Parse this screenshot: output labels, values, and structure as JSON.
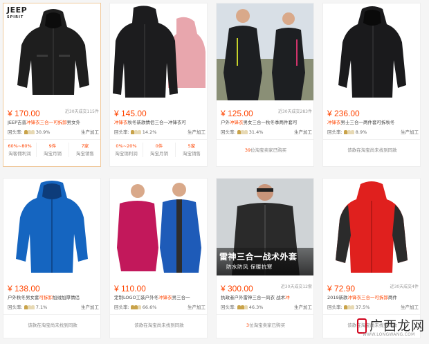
{
  "brand_logo": {
    "main": "JEEP",
    "sub": "SPIRIT"
  },
  "products": [
    {
      "price": "¥ 170.00",
      "sold": "近30天成交115件",
      "title_pre": "JEEP吉普",
      "title_hl": "冲锋衣三合一可拆卸",
      "title_post": "男女外",
      "shop_label": "回头率:",
      "rate": "30.9%",
      "supply": "生产加工",
      "stats": [
        {
          "value": "60%~80%",
          "label": "淘客佣利润"
        },
        {
          "value": "9件",
          "label": "淘宝月销"
        },
        {
          "value": "7家",
          "label": "淘宝销售"
        }
      ],
      "footer": null,
      "colors": {
        "jacket": "#1e1e1e",
        "accent": "#2b2b2b"
      }
    },
    {
      "price": "¥ 145.00",
      "sold": "",
      "title_pre": "",
      "title_hl": "冲锋衣",
      "title_post": "秋冬新款情侣三合一冲锋衣可",
      "shop_label": "回头率:",
      "rate": "14.2%",
      "supply": "生产加工",
      "stats": [
        {
          "value": "0%~20%",
          "label": "淘宝销利润"
        },
        {
          "value": "0件",
          "label": "淘宝月销"
        },
        {
          "value": "5家",
          "label": "淘宝销售"
        }
      ],
      "footer": null,
      "colors": {
        "jacket": "#1c1c1e",
        "accent": "#e8a6ad"
      }
    },
    {
      "price": "¥ 125.00",
      "sold": "近30天成交283件",
      "title_pre": "户外",
      "title_hl": "冲锋衣",
      "title_post": "男女三合一秋冬季两件套可",
      "shop_label": "回头率:",
      "rate": "31.4%",
      "supply": "生产加工",
      "stats": null,
      "footer": {
        "num": "39",
        "text": "位淘宝卖家已购买"
      },
      "colors": {
        "jacket": "#1d1f22",
        "accent": "#c7d32a"
      }
    },
    {
      "price": "¥ 236.00",
      "sold": "",
      "title_pre": "",
      "title_hl": "冲锋衣",
      "title_post": "男士三合一两件套可拆秋冬",
      "shop_label": "回头率:",
      "rate": "8.9%",
      "supply": "生产加工",
      "stats": null,
      "footer": {
        "num": "",
        "text": "该款在淘宝尚未找到同款"
      },
      "colors": {
        "jacket": "#1a1a1c",
        "accent": "#333"
      }
    },
    {
      "price": "¥ 138.00",
      "sold": "",
      "title_pre": "户外秋冬男女套",
      "title_hl": "可拆卸",
      "title_post": "加绒加厚情侣",
      "shop_label": "回头率:",
      "rate": "7.1%",
      "supply": "生产加工",
      "stats": null,
      "footer": {
        "num": "",
        "text": "该款在淘宝尚未找到同款"
      },
      "colors": {
        "jacket": "#1565c0",
        "accent": "#0d3c7a"
      }
    },
    {
      "price": "¥ 110.00",
      "sold": "",
      "title_pre": "定制LOGO工装户外冬",
      "title_hl": "冲锋衣",
      "title_post": "男三合一",
      "shop_label": "回头率:",
      "rate": "66.6%",
      "supply": "生产加工",
      "stats": null,
      "footer": {
        "num": "",
        "text": "该款在淘宝尚未找到同款"
      },
      "colors": {
        "jacket": "#c2185b",
        "accent": "#1e5bb8"
      }
    },
    {
      "price": "¥ 300.00",
      "sold": "近30天成交12套",
      "title_pre": "执政者户外雷神三合一风衣 战术",
      "title_hl": "冲",
      "title_post": "",
      "shop_label": "回头率:",
      "rate": "46.3%",
      "supply": "生产加工",
      "stats": null,
      "footer": {
        "num": "3",
        "text": "位淘宝卖家已购买"
      },
      "banner": {
        "line1": "雷神三合一战术外套",
        "line2": "防水防风  保暖抗寒"
      },
      "colors": {
        "jacket": "#2a2a2a",
        "accent": "#555"
      }
    },
    {
      "price": "¥ 72.90",
      "sold": "近30天成交4件",
      "title_pre": "2019新款",
      "title_hl": "冲锋衣三合一可拆卸",
      "title_post": "两件",
      "shop_label": "回头率:",
      "rate": "37.5%",
      "supply": "生产加工",
      "stats": null,
      "footer": {
        "num": "",
        "text": "该款在淘宝尚未找到同款"
      },
      "colors": {
        "jacket": "#e0201e",
        "accent": "#2b2b2b"
      }
    }
  ],
  "watermark": {
    "text": "广西龙网",
    "sub": "WWW.LONGWANG.COM"
  }
}
